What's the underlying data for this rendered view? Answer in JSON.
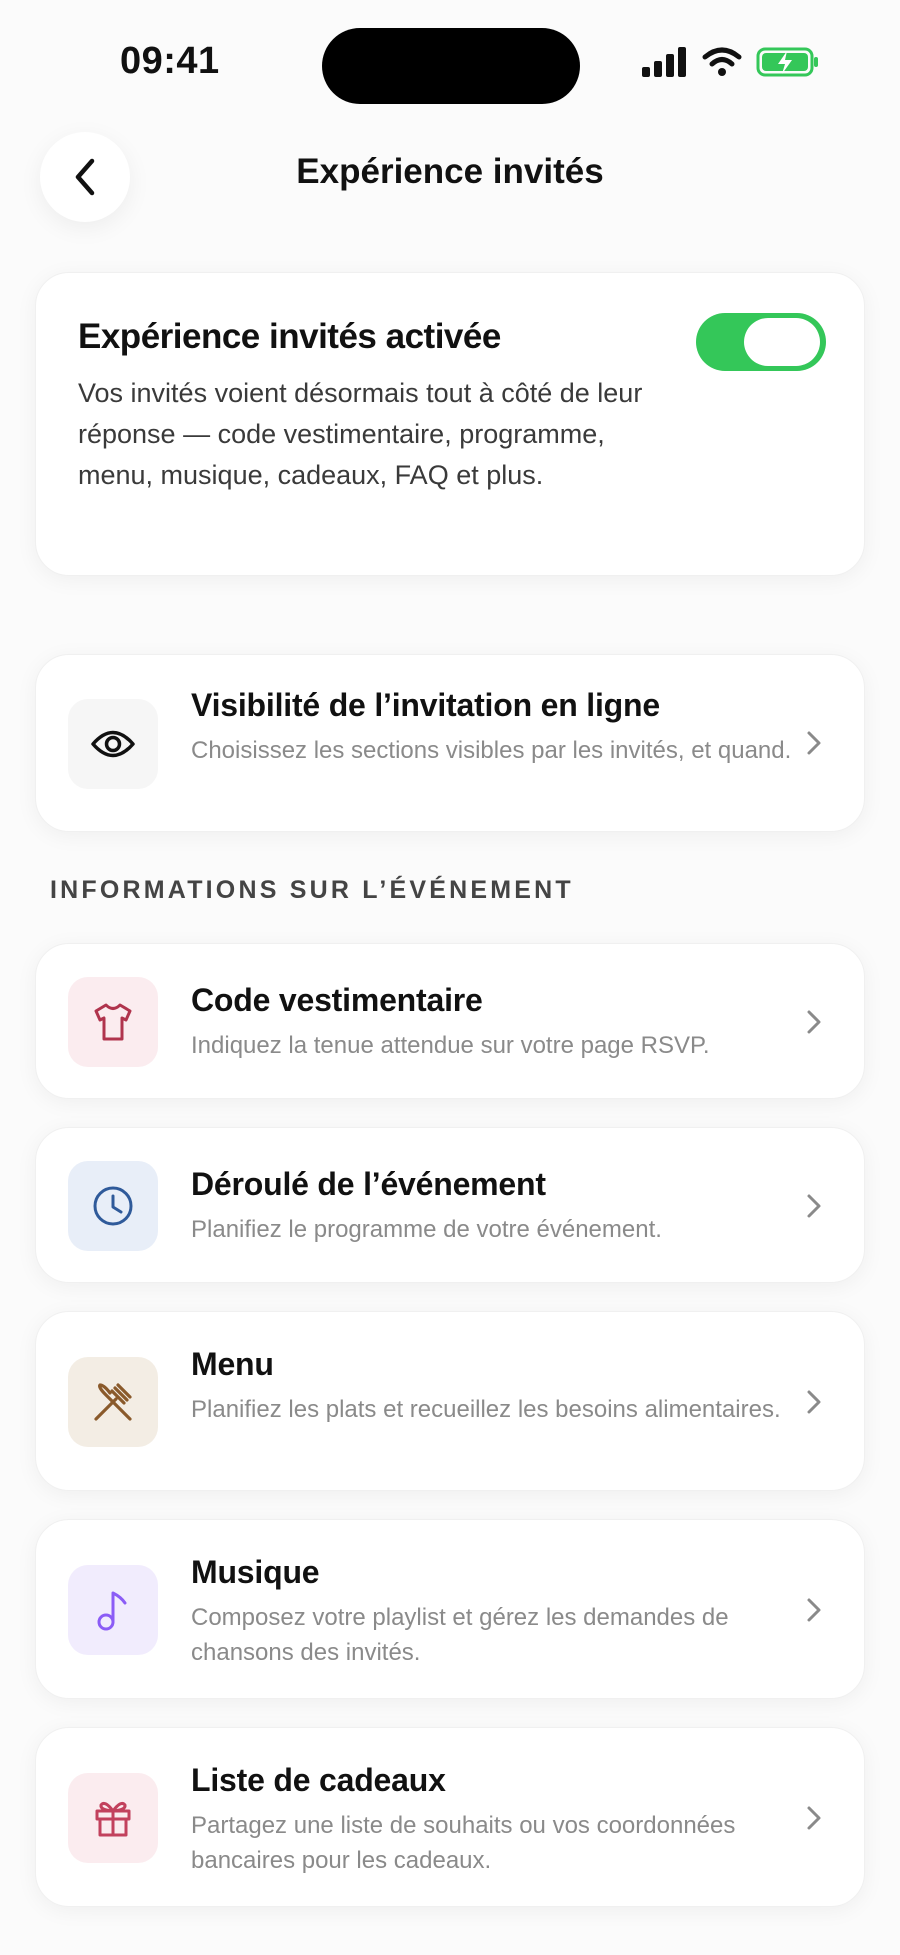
{
  "status": {
    "time": "09:41"
  },
  "nav": {
    "title": "Expérience invités"
  },
  "activation": {
    "title": "Expérience invités activée",
    "description": "Vos invités voient désormais tout à côté de leur réponse — code vestimentaire, programme, menu, musique, cadeaux, FAQ et plus.",
    "enabled": true
  },
  "visibility": {
    "title": "Visibilité de l’invitation en ligne",
    "subtitle": "Choisissez les sections visibles par les invités, et quand.",
    "icon": "eye-icon"
  },
  "section": {
    "header": "INFORMATIONS SUR L’ÉVÉNEMENT"
  },
  "items": [
    {
      "title": "Code vestimentaire",
      "subtitle": "Indiquez la tenue attendue sur votre page RSVP.",
      "icon": "shirt-icon",
      "bg": "#fbecef",
      "color": "#b0344d"
    },
    {
      "title": "Déroulé de l’événement",
      "subtitle": "Planifiez le programme de votre événement.",
      "icon": "clock-icon",
      "bg": "#e8eef8",
      "color": "#2f5a9a"
    },
    {
      "title": "Menu",
      "subtitle": "Planifiez les plats et recueillez les besoins alimentaires.",
      "icon": "utensils-icon",
      "bg": "#f3ede4",
      "color": "#8a5a2b"
    },
    {
      "title": "Musique",
      "subtitle": "Composez votre playlist et gérez les demandes de chansons des invités.",
      "icon": "music-note-icon",
      "bg": "#f1ecfd",
      "color": "#8b5cf6"
    },
    {
      "title": "Liste de cadeaux",
      "subtitle": "Partagez une liste de souhaits ou vos coordonnées bancaires pour les cadeaux.",
      "icon": "gift-icon",
      "bg": "#fbecef",
      "color": "#c2415d"
    }
  ]
}
